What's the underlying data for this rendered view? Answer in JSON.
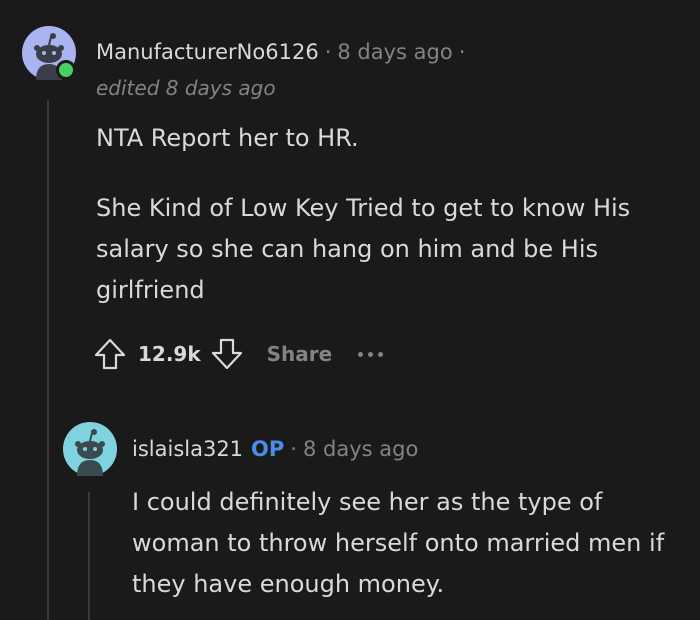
{
  "comment": {
    "username": "ManufacturerNo6126",
    "separator": "·",
    "time": "8 days ago",
    "trailing_separator": "·",
    "edited": "edited 8 days ago",
    "paragraphs": [
      "NTA Report her to HR.",
      "She Kind of Low Key Tried to get to know His salary so she can hang on him and be His girlfriend"
    ],
    "upvotes": "12.9k",
    "share_label": "Share",
    "user_online": true
  },
  "reply": {
    "username": "islaisla321",
    "op_badge": "OP",
    "separator": "·",
    "time": "8 days ago",
    "paragraphs": [
      "I could definitely see her as the type of woman to throw herself onto married men if they have enough money."
    ]
  },
  "icons": {
    "upvote": "upvote-arrow-icon",
    "downvote": "downvote-arrow-icon",
    "more": "more-options-icon",
    "avatar": "snoo-avatar-icon"
  },
  "colors": {
    "background": "#1a1a1b",
    "text": "#d7dadc",
    "muted": "#818384",
    "op": "#4a8ce8",
    "online": "#46d160",
    "avatar1_bg": "#aab4f0",
    "avatar2_bg": "#7fd3df"
  }
}
